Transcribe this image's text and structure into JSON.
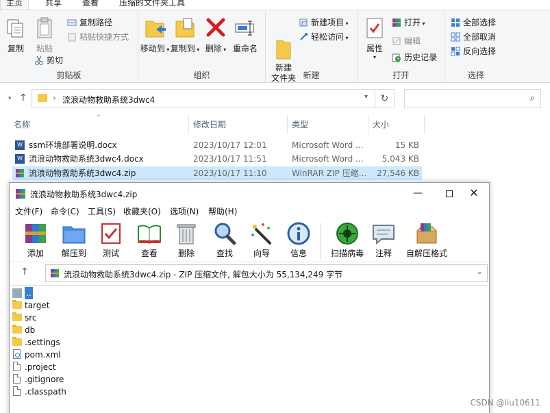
{
  "ribbon_tabs": [
    "主页",
    "共享",
    "查看",
    "压缩的文件夹工具"
  ],
  "clipboard": {
    "copy": "复制",
    "paste": "粘贴",
    "copy_path": "复制路径",
    "paste_shortcut": "粘贴快捷方式",
    "cut": "剪切",
    "label": "剪贴板"
  },
  "organize": {
    "move_to": "移动到",
    "copy_to": "复制到",
    "delete": "删除",
    "rename": "重命名",
    "label": "组织"
  },
  "new_group": {
    "new_folder": "新建\n文件夹",
    "new_item": "新建项目",
    "easy_access": "轻松访问",
    "label": "新建"
  },
  "open_group": {
    "properties": "属性",
    "open": "打开",
    "edit": "编辑",
    "history": "历史记录",
    "label": "打开"
  },
  "select_group": {
    "select_all": "全部选择",
    "select_none": "全部取消",
    "invert": "反向选择",
    "label": "选择"
  },
  "address": {
    "path": "流浪动物救助系统3dwc4"
  },
  "columns": {
    "name": "名称",
    "date": "修改日期",
    "type": "类型",
    "size": "大小"
  },
  "files": [
    {
      "name": "ssm环境部署说明.docx",
      "date": "2023/10/17 12:01",
      "type": "Microsoft Word ...",
      "size": "15 KB",
      "icon": "word-icon"
    },
    {
      "name": "流浪动物救助系统3dwc4.docx",
      "date": "2023/10/17 11:51",
      "type": "Microsoft Word ...",
      "size": "5,043 KB",
      "icon": "word-icon"
    },
    {
      "name": "流浪动物救助系统3dwc4.zip",
      "date": "2023/10/17 11:10",
      "type": "WinRAR ZIP 压缩...",
      "size": "27,546 KB",
      "icon": "winrar-icon"
    }
  ],
  "winrar": {
    "title": "流浪动物救助系统3dwc4.zip",
    "menu": [
      "文件(F)",
      "命令(C)",
      "工具(S)",
      "收藏夹(O)",
      "选项(N)",
      "帮助(H)"
    ],
    "toolbar": [
      "添加",
      "解压到",
      "测试",
      "查看",
      "删除",
      "查找",
      "向导",
      "信息",
      "扫描病毒",
      "注释",
      "自解压格式"
    ],
    "path_text": "流浪动物救助系统3dwc4.zip - ZIP 压缩文件, 解包大小为 55,134,249 字节",
    "items": [
      {
        "name": "..",
        "kind": "up"
      },
      {
        "name": "target",
        "kind": "folder"
      },
      {
        "name": "src",
        "kind": "folder"
      },
      {
        "name": "db",
        "kind": "folder"
      },
      {
        "name": ".settings",
        "kind": "folder"
      },
      {
        "name": "pom.xml",
        "kind": "xml"
      },
      {
        "name": ".project",
        "kind": "file"
      },
      {
        "name": ".gitignore",
        "kind": "file"
      },
      {
        "name": ".classpath",
        "kind": "file"
      }
    ]
  },
  "watermark": "CSDN @liu10611"
}
